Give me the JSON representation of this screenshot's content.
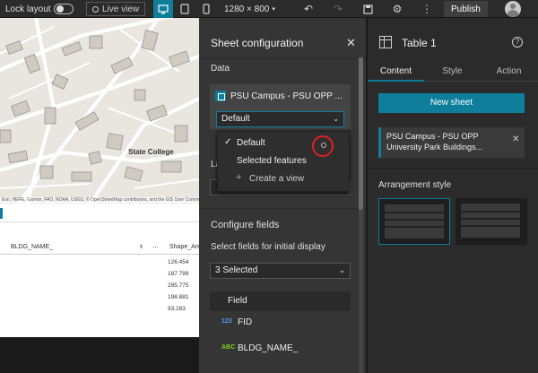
{
  "toolbar": {
    "lock_layout": "Lock layout",
    "live_view": "Live view",
    "resolution": "1280 × 800",
    "publish": "Publish"
  },
  "map": {
    "label": "State College",
    "attribution": "Esri, HERE, Garmin, FAO, NOAA, USGS, © OpenStreetMap contributors, and the GIS User Community"
  },
  "table": {
    "column_1": "BLDG_NAME_",
    "column_2": "Shape_Area",
    "values": [
      "126.454",
      "187.799",
      "295.775",
      "198.881",
      "93.283"
    ]
  },
  "sheet": {
    "title": "Sheet configuration",
    "data_label": "Data",
    "source_name": "PSU Campus - PSU OPP ...",
    "view_value": "Default",
    "dropdown": {
      "default": "Default",
      "selected_features": "Selected features",
      "create_view": "Create a view"
    },
    "layout_partial": "La",
    "configure_fields": "Configure fields",
    "select_fields": "Select fields for initial display",
    "selected_count": "3 Selected",
    "field_header": "Field",
    "fields": [
      {
        "type": "123",
        "name": "FID",
        "color": "#4aa3ff"
      },
      {
        "type": "ABC",
        "name": "BLDG_NAME_",
        "color": "#7ed321"
      }
    ]
  },
  "panel": {
    "title": "Table 1",
    "tabs": [
      "Content",
      "Style",
      "Action"
    ],
    "new_sheet": "New sheet",
    "sheet_item": "PSU Campus - PSU OPP University Park Buildings...",
    "arrangement_style": "Arrangement style"
  },
  "colors": {
    "accent": "#0e7e9a",
    "highlight_ring": "#e02020"
  }
}
